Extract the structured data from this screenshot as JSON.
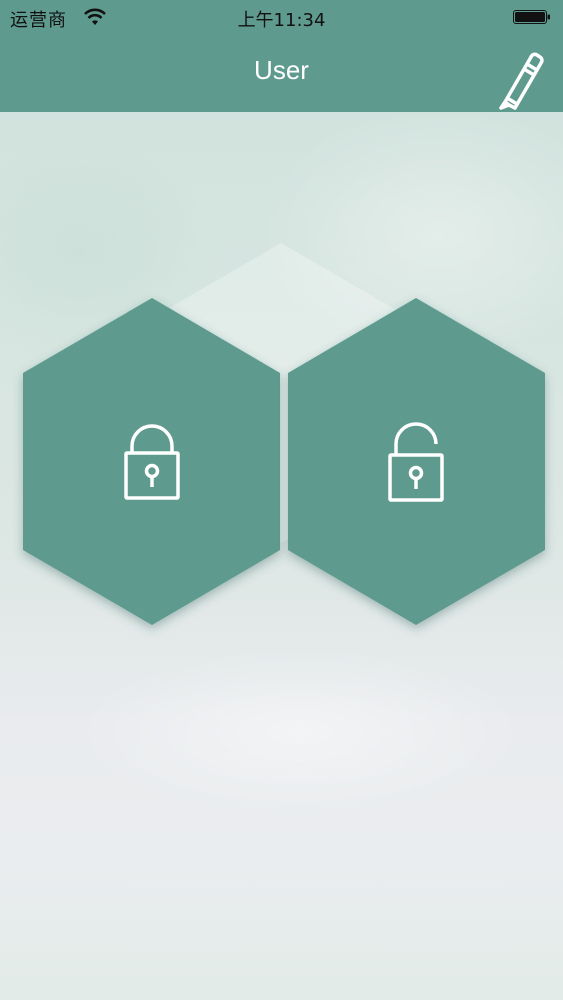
{
  "status_bar": {
    "carrier": "运营商",
    "time": "上午11:34",
    "wifi_icon": "wifi-icon",
    "battery_icon": "battery-icon"
  },
  "header": {
    "title": "User",
    "edit_icon": "pencil-icon"
  },
  "tiles": [
    {
      "name": "lock",
      "icon": "lock-closed-icon"
    },
    {
      "name": "unlock",
      "icon": "lock-open-icon"
    }
  ],
  "colors": {
    "primary": "#5f9a8f",
    "tile": "#5f9a8f",
    "icon_stroke": "#ffffff"
  }
}
